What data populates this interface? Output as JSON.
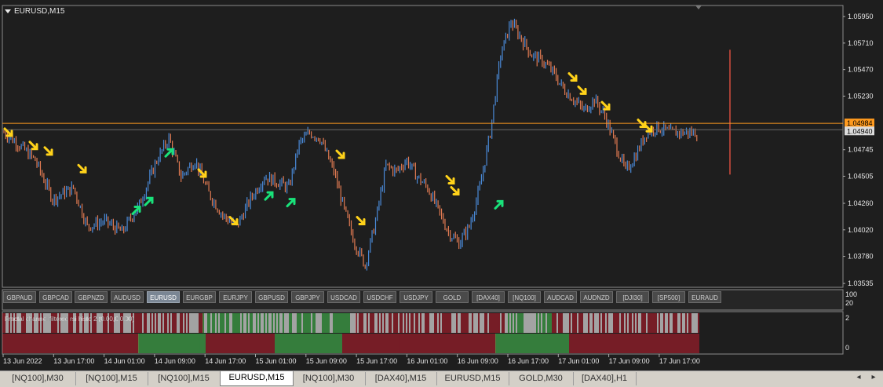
{
  "chart_data": {
    "type": "candlestick",
    "title": "EURUSD,M15",
    "ylim": [
      1.035,
      1.0605
    ],
    "y_ticks": [
      "1.05950",
      "1.05710",
      "1.05470",
      "1.05230",
      "1.04984",
      "1.04940",
      "1.04745",
      "1.04505",
      "1.04260",
      "1.04020",
      "1.03780",
      "1.03535"
    ],
    "x_ticks": [
      "13 Jun 2022",
      "13 Jun 17:00",
      "14 Jun 01:00",
      "14 Jun 09:00",
      "14 Jun 17:00",
      "15 Jun 01:00",
      "15 Jun 09:00",
      "15 Jun 17:00",
      "16 Jun 01:00",
      "16 Jun 09:00",
      "16 Jun 17:00",
      "17 Jun 01:00",
      "17 Jun 09:00",
      "17 Jun 17:00"
    ],
    "price_anchors": [
      [
        0,
        1.049
      ],
      [
        8,
        1.048
      ],
      [
        18,
        1.0465
      ],
      [
        28,
        1.043
      ],
      [
        40,
        1.044
      ],
      [
        48,
        1.0405
      ],
      [
        58,
        1.041
      ],
      [
        68,
        1.04
      ],
      [
        78,
        1.0425
      ],
      [
        88,
        1.0465
      ],
      [
        95,
        1.0485
      ],
      [
        102,
        1.045
      ],
      [
        110,
        1.0465
      ],
      [
        118,
        1.0435
      ],
      [
        126,
        1.0415
      ],
      [
        134,
        1.0405
      ],
      [
        142,
        1.043
      ],
      [
        150,
        1.045
      ],
      [
        158,
        1.0445
      ],
      [
        164,
        1.044
      ],
      [
        170,
        1.048
      ],
      [
        176,
        1.049
      ],
      [
        182,
        1.0485
      ],
      [
        190,
        1.0455
      ],
      [
        196,
        1.042
      ],
      [
        202,
        1.039
      ],
      [
        208,
        1.037
      ],
      [
        214,
        1.041
      ],
      [
        220,
        1.046
      ],
      [
        226,
        1.0455
      ],
      [
        232,
        1.0465
      ],
      [
        238,
        1.045
      ],
      [
        244,
        1.044
      ],
      [
        250,
        1.042
      ],
      [
        256,
        1.04
      ],
      [
        262,
        1.039
      ],
      [
        268,
        1.0405
      ],
      [
        274,
        1.044
      ],
      [
        280,
        1.049
      ],
      [
        286,
        1.056
      ],
      [
        292,
        1.059
      ],
      [
        298,
        1.0575
      ],
      [
        304,
        1.056
      ],
      [
        310,
        1.0555
      ],
      [
        316,
        1.0545
      ],
      [
        322,
        1.053
      ],
      [
        328,
        1.052
      ],
      [
        334,
        1.051
      ],
      [
        340,
        1.052
      ],
      [
        346,
        1.0505
      ],
      [
        352,
        1.048
      ],
      [
        358,
        1.0455
      ],
      [
        364,
        1.047
      ],
      [
        370,
        1.049
      ],
      [
        376,
        1.0495
      ],
      [
        384,
        1.049
      ]
    ],
    "up_arrows": [
      [
        174,
        1.042
      ],
      [
        190,
        1.0428
      ],
      [
        216,
        1.0472
      ],
      [
        343,
        1.0433
      ],
      [
        371,
        1.0427
      ],
      [
        636,
        1.0425
      ]
    ],
    "down_arrows": [
      [
        11,
        1.049
      ],
      [
        43,
        1.0478
      ],
      [
        62,
        1.0473
      ],
      [
        105,
        1.0457
      ],
      [
        258,
        1.0453
      ],
      [
        298,
        1.041
      ],
      [
        434,
        1.047
      ],
      [
        460,
        1.041
      ],
      [
        574,
        1.0447
      ],
      [
        580,
        1.0437
      ],
      [
        730,
        1.054
      ],
      [
        742,
        1.0528
      ],
      [
        772,
        1.0514
      ],
      [
        818,
        1.0498
      ],
      [
        826,
        1.0494
      ]
    ],
    "last_price": 1.04984,
    "bid_price": 1.0494,
    "hist_ylim": [
      0,
      2
    ],
    "hist_ticks": [
      "2",
      "0"
    ],
    "hist_lower_segments": [
      [
        0,
        173,
        "red"
      ],
      [
        173,
        259,
        "green"
      ],
      [
        259,
        347,
        "red"
      ],
      [
        347,
        433,
        "green"
      ],
      [
        433,
        628,
        "red"
      ],
      [
        628,
        722,
        "green"
      ],
      [
        722,
        888,
        "red"
      ]
    ],
    "hist_upper_segments": [
      [
        0,
        255,
        "mixed-red"
      ],
      [
        255,
        450,
        "mixed-green"
      ],
      [
        450,
        640,
        "mixed-red"
      ],
      [
        640,
        700,
        "mixed-green"
      ],
      [
        700,
        888,
        "mixed-red"
      ]
    ],
    "subwindow_ticks": [
      "100",
      "20"
    ]
  },
  "window": {
    "title": "EURUSD,M15",
    "indicator_label": "Fractal channel filtered rsi histo 2 (0.00,0,0.00)"
  },
  "symbols": [
    {
      "label": "GBPAUD",
      "active": false
    },
    {
      "label": "GBPCAD",
      "active": false
    },
    {
      "label": "GBPNZD",
      "active": false
    },
    {
      "label": "AUDUSD",
      "active": false
    },
    {
      "label": "EURUSD",
      "active": true
    },
    {
      "label": "EURGBP",
      "active": false
    },
    {
      "label": "EURJPY",
      "active": false
    },
    {
      "label": "GBPUSD",
      "active": false
    },
    {
      "label": "GBPJPY",
      "active": false
    },
    {
      "label": "USDCAD",
      "active": false
    },
    {
      "label": "USDCHF",
      "active": false
    },
    {
      "label": "USDJPY",
      "active": false
    },
    {
      "label": "GOLD",
      "active": false
    },
    {
      "label": "[DAX40]",
      "active": false
    },
    {
      "label": "[NQ100]",
      "active": false
    },
    {
      "label": "AUDCAD",
      "active": false
    },
    {
      "label": "AUDNZD",
      "active": false
    },
    {
      "label": "[DJI30]",
      "active": false
    },
    {
      "label": "[SP500]",
      "active": false
    },
    {
      "label": "EURAUD",
      "active": false
    }
  ],
  "tabs": [
    {
      "label": "[NQ100],M30",
      "active": false
    },
    {
      "label": "[NQ100],M15",
      "active": false
    },
    {
      "label": "[NQ100],M15",
      "active": false
    },
    {
      "label": "EURUSD,M15",
      "active": true
    },
    {
      "label": "[NQ100],M30",
      "active": false
    },
    {
      "label": "[DAX40],M15",
      "active": false
    },
    {
      "label": "EURUSD,M15",
      "active": false
    },
    {
      "label": "GOLD,M30",
      "active": false
    },
    {
      "label": "[DAX40],H1",
      "active": false
    }
  ],
  "nav": {
    "left": "◂",
    "right": "▸"
  },
  "colors": {
    "bg": "#1e1e1e",
    "up": "#4a8ad8",
    "down": "#e07a52",
    "price_line": "#ff9a1e",
    "red": "#9c1d2a",
    "green": "#3fa64a",
    "arrow_up": "#19e27a",
    "arrow_down": "#ffd21a"
  }
}
